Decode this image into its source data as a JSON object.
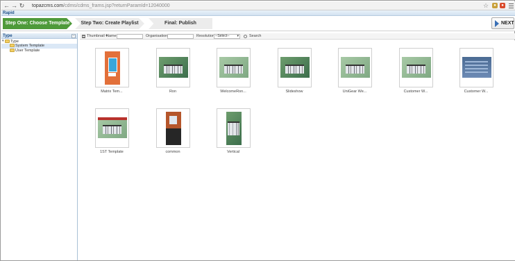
{
  "browser": {
    "url_host": "topazcms.com",
    "url_path": "/cdms/cdms_frams.jsp?returnParamId=12040000"
  },
  "app": {
    "title": "Rapid"
  },
  "wizard": {
    "steps": [
      {
        "label": "Step One: Choose Template",
        "active": true
      },
      {
        "label": "Step Two: Create Playlist",
        "active": false
      },
      {
        "label": "Final: Publish",
        "active": false
      }
    ],
    "next_label": "NEXT"
  },
  "sidebar": {
    "title": "Type",
    "tree": [
      {
        "label": "Type",
        "level": 0,
        "expanded": true
      },
      {
        "label": "System Template",
        "level": 1,
        "selected": true
      },
      {
        "label": "User Template",
        "level": 1,
        "selected": false
      }
    ]
  },
  "filters": {
    "view_label": "Thumbnail",
    "name_label": "Name:",
    "name_value": "",
    "organisation_label": "Organisation:",
    "organisation_value": "",
    "resolution_label": "Resolution:",
    "resolution_value": "--Select--",
    "search_label": "Search"
  },
  "templates": [
    {
      "caption": "Matrix Tem...",
      "image": "orange-portrait"
    },
    {
      "caption": "Ron",
      "image": "green-stands"
    },
    {
      "caption": "WelcomeRon...",
      "image": "light-stands"
    },
    {
      "caption": "Slideshow",
      "image": "green-stands"
    },
    {
      "caption": "UniGear We...",
      "image": "light-stands"
    },
    {
      "caption": "Customer W...",
      "image": "light-stands"
    },
    {
      "caption": "Customer W...",
      "image": "blue-dashboard"
    },
    {
      "caption": "1ST Template",
      "image": "red-header-stands"
    },
    {
      "caption": "common",
      "image": "common-portrait"
    },
    {
      "caption": "Vertical",
      "image": "vertical-stands"
    }
  ],
  "colors": {
    "active_step": "#4e9a3a",
    "inactive_step": "#ececec",
    "accent_blue": "#1c4e86"
  }
}
